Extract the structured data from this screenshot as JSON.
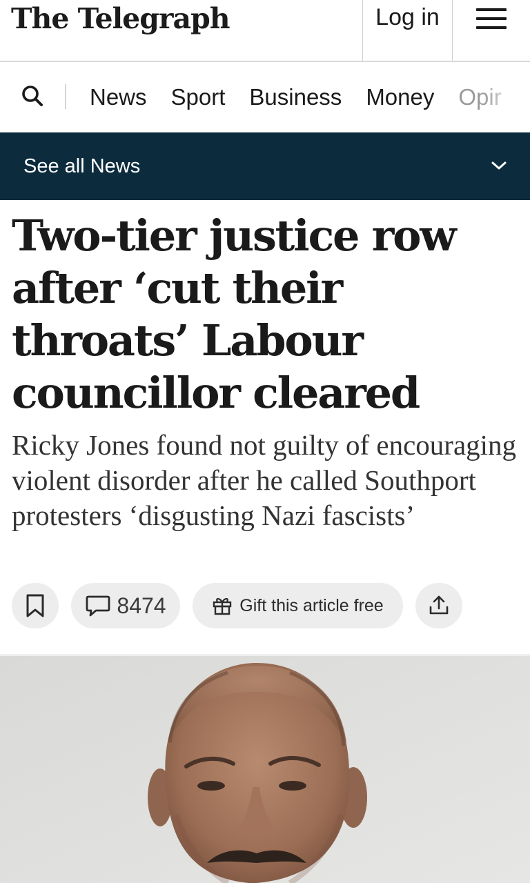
{
  "masthead": {
    "logo_text": "The Telegraph",
    "login_label": "Log in",
    "menu_icon": "hamburger-menu-icon"
  },
  "nav": {
    "search_icon": "search-icon",
    "items": [
      {
        "label": "News"
      },
      {
        "label": "Sport"
      },
      {
        "label": "Business"
      },
      {
        "label": "Money"
      },
      {
        "label": "Opir"
      }
    ]
  },
  "section_bar": {
    "label": "See all News",
    "icon": "chevron-down-icon",
    "background": "#0c2b3d"
  },
  "article": {
    "headline": "Two-tier justice row after ‘cut their throats’ Labour councillor cleared",
    "standfirst": "Ricky Jones found not guilty of encouraging violent disorder after he called Southport protesters ‘disgusting Nazi fascists’"
  },
  "actions": {
    "bookmark_icon": "bookmark-icon",
    "comments_icon": "comment-bubble-icon",
    "comments_count": "8474",
    "gift_icon": "gift-icon",
    "gift_label": "Gift this article free",
    "share_icon": "share-upload-icon"
  },
  "lead_image": {
    "subject": "portrait photo of a bald man with a moustache against a light grey wall"
  }
}
